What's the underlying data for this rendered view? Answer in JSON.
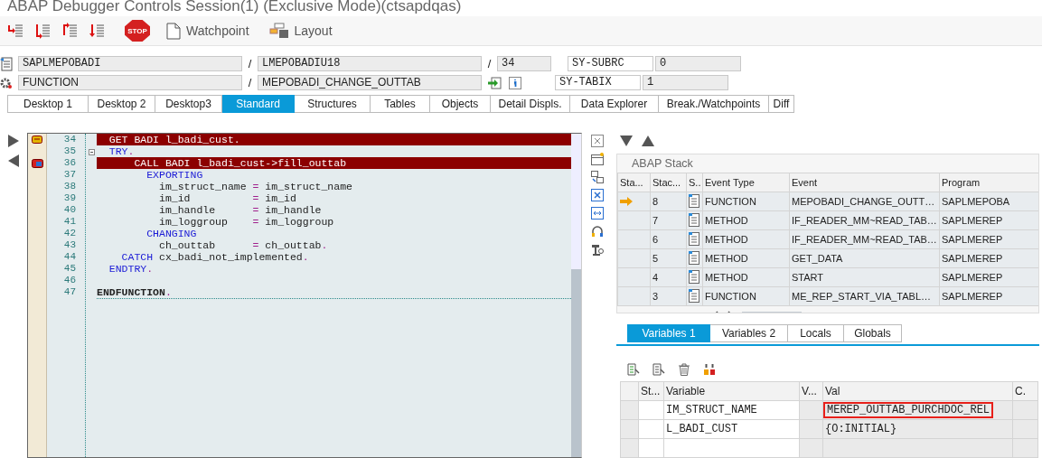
{
  "window": {
    "title": "ABAP Debugger Controls Session(1)  (Exclusive Mode)(ctsapdqas)"
  },
  "toolbar": {
    "step_buttons": [
      {
        "kind": "step-into"
      },
      {
        "kind": "execute"
      },
      {
        "kind": "return"
      },
      {
        "kind": "continue"
      }
    ],
    "stop": {
      "label": "STOP"
    },
    "buttons": [
      {
        "kind": "watchpoint",
        "label": "Watchpoint"
      },
      {
        "kind": "layout",
        "label": "Layout"
      }
    ]
  },
  "source_rows": [
    {
      "kind": "program",
      "parts": [
        {
          "kind": "field",
          "text": "SAPLMEPOBADI"
        },
        {
          "kind": "separator",
          "text": "/"
        },
        {
          "kind": "field",
          "text": "LMEPOBADIU18"
        },
        {
          "kind": "separator",
          "text": "/"
        },
        {
          "kind": "short-field",
          "text": "34"
        }
      ]
    },
    {
      "kind": "event",
      "parts": [
        {
          "kind": "field",
          "text": "FUNCTION"
        },
        {
          "kind": "separator",
          "text": "/"
        },
        {
          "kind": "field",
          "text": "MEPOBADI_CHANGE_OUTTAB"
        },
        {
          "kind": "actions"
        }
      ]
    }
  ],
  "system_fields": [
    {
      "name": "SY-SUBRC",
      "value": "0"
    },
    {
      "name": "SY-TABIX",
      "value": "1"
    }
  ],
  "tabs": [
    {
      "label": "Desktop 1",
      "selected": false
    },
    {
      "label": "Desktop 2",
      "selected": false
    },
    {
      "label": "Desktop3",
      "selected": false
    },
    {
      "label": "Standard",
      "selected": true
    },
    {
      "label": "Structures",
      "selected": false
    },
    {
      "label": "Tables",
      "selected": false
    },
    {
      "label": "Objects",
      "selected": false
    },
    {
      "label": "Detail Displs.",
      "selected": false
    },
    {
      "label": "Data Explorer",
      "selected": false
    },
    {
      "label": "Break./Watchpoints",
      "selected": false
    },
    {
      "label": "Diff",
      "selected": false
    }
  ],
  "code": {
    "lines": [
      {
        "number": "34",
        "highlighted": true,
        "marker": {
          "kind": "breakpoint"
        },
        "segments": [
          {
            "text": "  GET BADI l_badi_cust.",
            "kind": "plain"
          }
        ]
      },
      {
        "number": "35",
        "highlighted": false,
        "segments": [
          {
            "text": "  TRY",
            "kind": "keyword"
          },
          {
            "text": ".",
            "kind": "operator"
          }
        ]
      },
      {
        "number": "36",
        "highlighted": true,
        "marker": {
          "kind": "current"
        },
        "segments": [
          {
            "text": "      CALL BADI l_badi_cust->fill_outtab",
            "kind": "plain"
          }
        ]
      },
      {
        "number": "37",
        "highlighted": false,
        "segments": [
          {
            "text": "        EXPORTING",
            "kind": "keyword"
          }
        ]
      },
      {
        "number": "38",
        "highlighted": false,
        "segments": [
          {
            "text": "          im_struct_name ",
            "kind": "plain"
          },
          {
            "text": "=",
            "kind": "operator"
          },
          {
            "text": " im_struct_name",
            "kind": "plain"
          }
        ]
      },
      {
        "number": "39",
        "highlighted": false,
        "segments": [
          {
            "text": "          im_id          ",
            "kind": "plain"
          },
          {
            "text": "=",
            "kind": "operator"
          },
          {
            "text": " im_id",
            "kind": "plain"
          }
        ]
      },
      {
        "number": "40",
        "highlighted": false,
        "segments": [
          {
            "text": "          im_handle      ",
            "kind": "plain"
          },
          {
            "text": "=",
            "kind": "operator"
          },
          {
            "text": " im_handle",
            "kind": "plain"
          }
        ]
      },
      {
        "number": "41",
        "highlighted": false,
        "segments": [
          {
            "text": "          im_loggroup    ",
            "kind": "plain"
          },
          {
            "text": "=",
            "kind": "operator"
          },
          {
            "text": " im_loggroup",
            "kind": "plain"
          }
        ]
      },
      {
        "number": "42",
        "highlighted": false,
        "segments": [
          {
            "text": "        CHANGING",
            "kind": "keyword"
          }
        ]
      },
      {
        "number": "43",
        "highlighted": false,
        "segments": [
          {
            "text": "          ch_outtab      ",
            "kind": "plain"
          },
          {
            "text": "=",
            "kind": "operator"
          },
          {
            "text": " ch_outtab",
            "kind": "plain"
          },
          {
            "text": ".",
            "kind": "operator"
          }
        ]
      },
      {
        "number": "44",
        "highlighted": false,
        "segments": [
          {
            "text": "    CATCH",
            "kind": "keyword"
          },
          {
            "text": " cx_badi_not_implemented",
            "kind": "plain"
          },
          {
            "text": ".",
            "kind": "operator"
          }
        ]
      },
      {
        "number": "45",
        "highlighted": false,
        "segments": [
          {
            "text": "  ENDTRY",
            "kind": "keyword"
          },
          {
            "text": ".",
            "kind": "operator"
          }
        ]
      },
      {
        "number": "46",
        "highlighted": false
      },
      {
        "number": "47",
        "highlighted": false,
        "segments": [
          {
            "text": "ENDFUNCTION",
            "kind": "strong"
          },
          {
            "text": ".",
            "kind": "operator"
          }
        ]
      }
    ]
  },
  "stack": {
    "title": "ABAP Stack",
    "columns": [
      "Sta...",
      "Stac...",
      "S..",
      "Event Type",
      "Event",
      "Program"
    ],
    "rows": [
      {
        "current": true,
        "level": "8",
        "event_type": "FUNCTION",
        "event": "MEPOBADI_CHANGE_OUTT…",
        "program": "SAPLMEPOBA"
      },
      {
        "current": false,
        "level": "7",
        "event_type": "METHOD",
        "event": "IF_READER_MM~READ_TAB…",
        "program": "SAPLMEREP"
      },
      {
        "current": false,
        "level": "6",
        "event_type": "METHOD",
        "event": "IF_READER_MM~READ_TAB…",
        "program": "SAPLMEREP"
      },
      {
        "current": false,
        "level": "5",
        "event_type": "METHOD",
        "event": "GET_DATA",
        "program": "SAPLMEREP"
      },
      {
        "current": false,
        "level": "4",
        "event_type": "METHOD",
        "event": "START",
        "program": "SAPLMEREP"
      },
      {
        "current": false,
        "level": "3",
        "event_type": "FUNCTION",
        "event": "ME_REP_START_VIA_TABL…",
        "program": "SAPLMEREP"
      }
    ]
  },
  "variable_tabs": [
    {
      "label": "Variables 1",
      "selected": true
    },
    {
      "label": "Variables 2",
      "selected": false
    },
    {
      "label": "Locals",
      "selected": false
    },
    {
      "label": "Globals",
      "selected": false
    }
  ],
  "variables": {
    "columns": [
      "St...",
      "Variable",
      "V...",
      "Val",
      "C."
    ],
    "rows": [
      {
        "variable": "IM_STRUCT_NAME",
        "value": "MEREP_OUTTAB_PURCHDOC_REL",
        "outlined": true
      },
      {
        "variable": "L_BADI_CUST",
        "value": "{O:INITIAL}",
        "outlined": false
      }
    ]
  }
}
